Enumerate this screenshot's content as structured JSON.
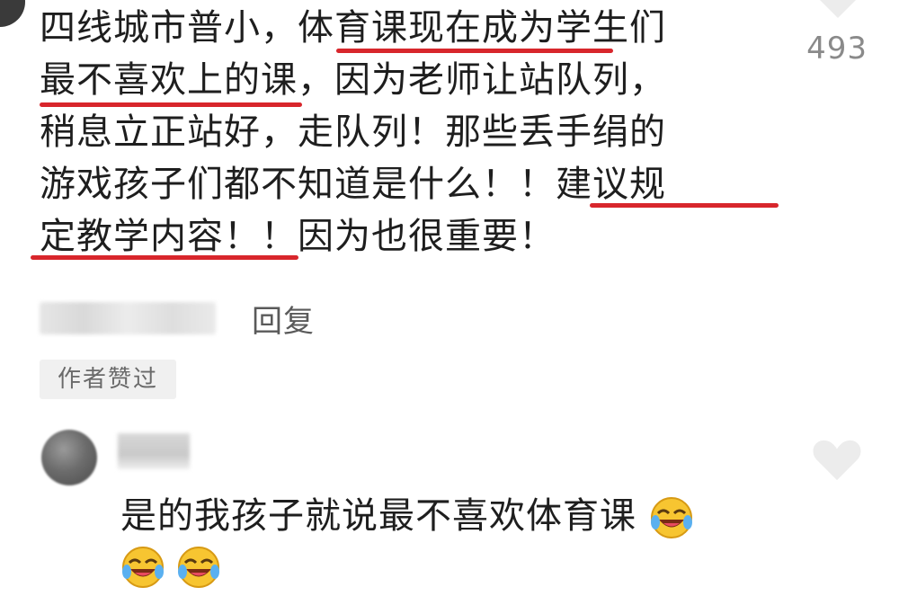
{
  "comment": {
    "lines": [
      "四线城市普小，体育课现在成为学生们",
      "最不喜欢上的课，因为老师让站队列，",
      "稍息立正站好，走队列！那些丢手绢的",
      "游戏孩子们都不知道是什么！！建议规",
      "定教学内容！！因为也很重要！"
    ],
    "like_count": "493",
    "reply_label": "回复",
    "author_badge": "作者赞过"
  },
  "reply": {
    "text": "是的我孩子就说最不喜欢体育课"
  },
  "icons": {
    "like": "heart-icon",
    "emoji": "laughing-crying-emoji-icon"
  },
  "colors": {
    "underline": "#d8262c",
    "heart": "#ececec",
    "count": "#8a8a8a"
  }
}
